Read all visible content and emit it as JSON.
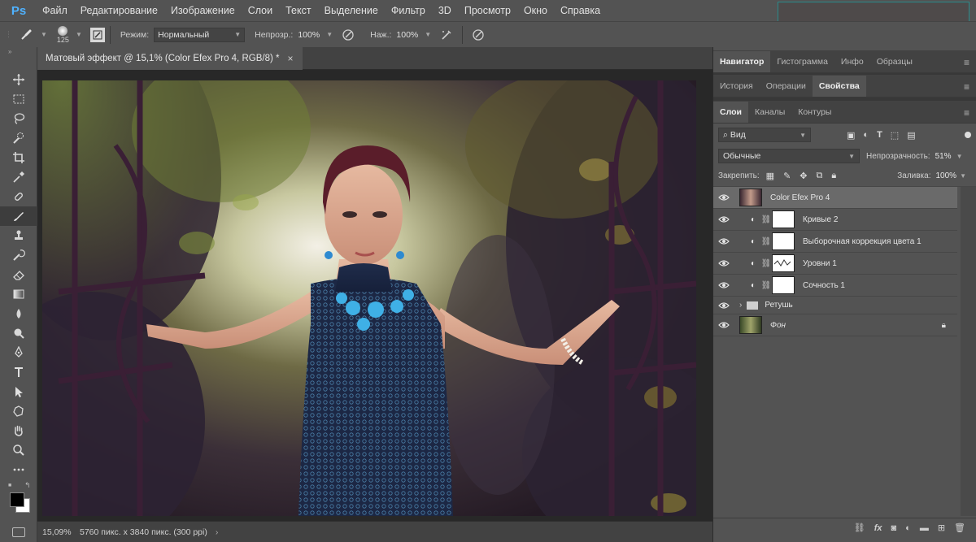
{
  "app": {
    "logo": "Ps"
  },
  "menu": {
    "items": [
      "Файл",
      "Редактирование",
      "Изображение",
      "Слои",
      "Текст",
      "Выделение",
      "Фильтр",
      "3D",
      "Просмотр",
      "Окно",
      "Справка"
    ]
  },
  "options": {
    "brush_size": "125",
    "mode_label": "Режим:",
    "mode_value": "Нормальный",
    "opacity_label": "Непрозр.:",
    "opacity_value": "100%",
    "flow_label": "Наж.:",
    "flow_value": "100%"
  },
  "document": {
    "tab_title": "Матовый эффект @ 15,1% (Color Efex Pro 4, RGB/8) *",
    "close_symbol": "×",
    "zoom": "15,09%",
    "info": "5760 пикс. х 3840 пикс. (300 ppi)",
    "status_arrow": "›"
  },
  "panels": {
    "row1_tabs": [
      "Навигатор",
      "Гистограмма",
      "Инфо",
      "Образцы"
    ],
    "row2_tabs": [
      "История",
      "Операции",
      "Свойства"
    ],
    "row3_tabs": [
      "Слои",
      "Каналы",
      "Контуры"
    ],
    "filter_label": "Вид",
    "blend_mode": "Обычные",
    "opacity_label": "Непрозрачность:",
    "opacity_value": "51%",
    "lock_label": "Закрепить:",
    "fill_label": "Заливка:",
    "fill_value": "100%"
  },
  "layers": [
    {
      "name": "Color Efex Pro 4",
      "type": "smart",
      "selected": true
    },
    {
      "name": "Кривые 2",
      "type": "adjustment",
      "selected": false
    },
    {
      "name": "Выборочная коррекция цвета 1",
      "type": "adjustment",
      "selected": false
    },
    {
      "name": "Уровни 1",
      "type": "adjustment",
      "selected": false
    },
    {
      "name": "Сочность 1",
      "type": "adjustment",
      "selected": false
    },
    {
      "name": "Ретушь",
      "type": "group",
      "selected": false
    },
    {
      "name": "Фон",
      "type": "background",
      "selected": false
    }
  ],
  "colors": {
    "accent_blue": "#4fb2ff",
    "panel_bg": "#535353",
    "selected_layer": "#6a6a6a"
  },
  "icons": [
    "move-icon",
    "marquee-icon",
    "lasso-icon",
    "quick-select-icon",
    "crop-icon",
    "eyedropper-icon",
    "healing-icon",
    "brush-icon",
    "stamp-icon",
    "history-brush-icon",
    "eraser-icon",
    "gradient-icon",
    "blur-icon",
    "dodge-icon",
    "pen-icon",
    "type-icon",
    "path-select-icon",
    "shape-icon",
    "hand-icon",
    "zoom-icon",
    "more-icon"
  ]
}
